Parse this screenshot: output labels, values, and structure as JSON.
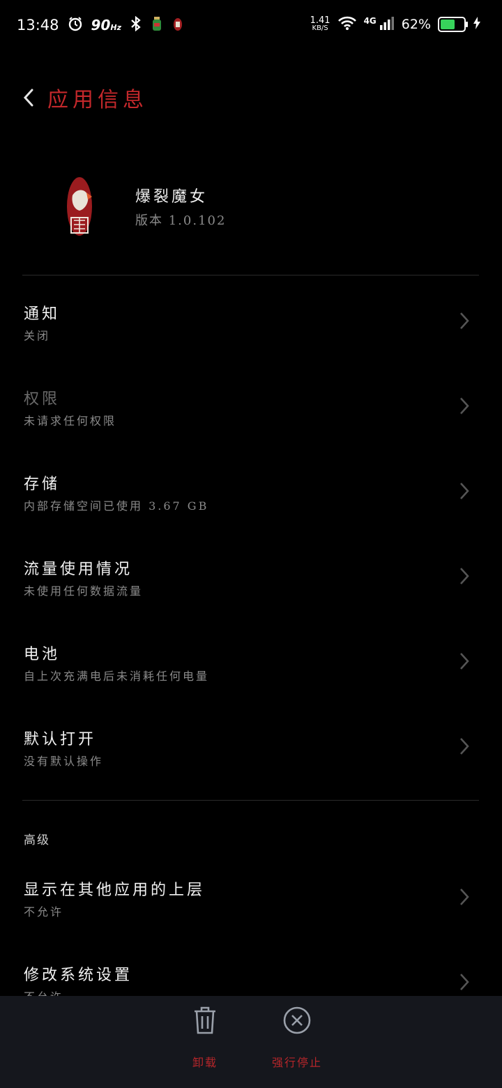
{
  "status_bar": {
    "time": "13:48",
    "refresh_rate": "90",
    "refresh_unit": "Hz",
    "net_speed": "1.41",
    "net_speed_unit": "KB/S",
    "network_type": "4G",
    "battery_percent": "62%",
    "battery_level": 0.62,
    "battery_color": "#37d35b"
  },
  "header": {
    "title": "应用信息"
  },
  "app": {
    "name": "爆裂魔女",
    "version": "版本 1.0.102"
  },
  "settings": [
    {
      "title": "通知",
      "subtitle": "关闭"
    },
    {
      "title": "权限",
      "subtitle": "未请求任何权限"
    },
    {
      "title": "存储",
      "subtitle": "内部存储空间已使用 3.67 GB"
    },
    {
      "title": "流量使用情况",
      "subtitle": "未使用任何数据流量"
    },
    {
      "title": "电池",
      "subtitle": "自上次充满电后未消耗任何电量"
    },
    {
      "title": "默认打开",
      "subtitle": "没有默认操作"
    }
  ],
  "advanced": {
    "label": "高级",
    "items": [
      {
        "title": "显示在其他应用的上层",
        "subtitle": "不允许"
      },
      {
        "title": "修改系统设置",
        "subtitle": "不允许"
      }
    ]
  },
  "bottom_bar": {
    "uninstall_label": "卸载",
    "force_stop_label": "强行停止"
  },
  "colors": {
    "accent": "#c4282b",
    "background": "#000000",
    "bottom_bar": "#15171d"
  }
}
